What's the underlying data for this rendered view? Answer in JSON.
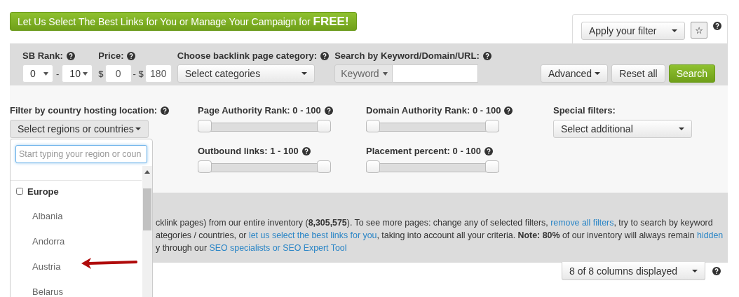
{
  "promo_banner": {
    "text": "Let Us Select The Best Links for You or Manage Your Campaign for",
    "emphasis": "FREE!"
  },
  "saved_filter": {
    "select": "Apply your filter",
    "star": "☆"
  },
  "search_bar": {
    "sb_rank": {
      "label": "SB Rank:",
      "from": "0",
      "separator": "-",
      "to": "10"
    },
    "price": {
      "label": "Price:",
      "currency": "$",
      "from": "0",
      "separator": "- $",
      "to": "180"
    },
    "category": {
      "label": "Choose backlink page category:",
      "select": "Select categories"
    },
    "keyword_search": {
      "label": "Search by Keyword/Domain/URL:",
      "mode": "Keyword"
    },
    "buttons": [
      {
        "label": "Advanced",
        "kind": "dropdown"
      },
      {
        "label": "Reset all",
        "kind": "default"
      },
      {
        "label": "Search",
        "kind": "primary"
      }
    ]
  },
  "filters": {
    "country": {
      "label": "Filter by country hosting location:",
      "select": "Select regions or countries"
    },
    "sliders": [
      {
        "label": "Page Authority Rank: 0 - 100",
        "level": 1
      },
      {
        "label": "Domain Authority Rank: 0 - 100",
        "level": 1
      },
      {
        "label": "Outbound links: 1 - 100",
        "level": 1
      },
      {
        "label": "Placement percent: 0 - 100",
        "level": 1
      }
    ],
    "special": {
      "label": "Special filters:",
      "select": "Select additional"
    }
  },
  "info_lines": [
    [
      {
        "kind": "text",
        "text": "cklink pages) from our entire inventory (**8,305,575**). To see more pages: change any of selected filters, "
      },
      {
        "kind": "link",
        "text": "remove all filters"
      },
      {
        "kind": "text",
        "text": ", try to search by keyword"
      }
    ],
    [
      {
        "kind": "text",
        "text": "ategories / countries, or "
      },
      {
        "kind": "link",
        "text": "let us select the best links for you"
      },
      {
        "kind": "text",
        "text": ", taking into account all your criteria. **Note: 80%** of our inventory will always remain "
      },
      {
        "kind": "link",
        "text": "hidden"
      }
    ],
    [
      {
        "kind": "text",
        "text": "y through our "
      },
      {
        "kind": "link",
        "text": "SEO specialists or SEO Expert Tool"
      }
    ]
  ],
  "columns_select": "8 of 8 columns displayed",
  "country_dropdown": {
    "placeholder": "Start typing your region or coun",
    "groups": [
      {
        "label": "Europe",
        "checked": false,
        "children": [
          {
            "label": "Albania"
          },
          {
            "label": "Andorra"
          },
          {
            "label": "Austria"
          },
          {
            "label": "Belarus"
          }
        ]
      }
    ]
  }
}
